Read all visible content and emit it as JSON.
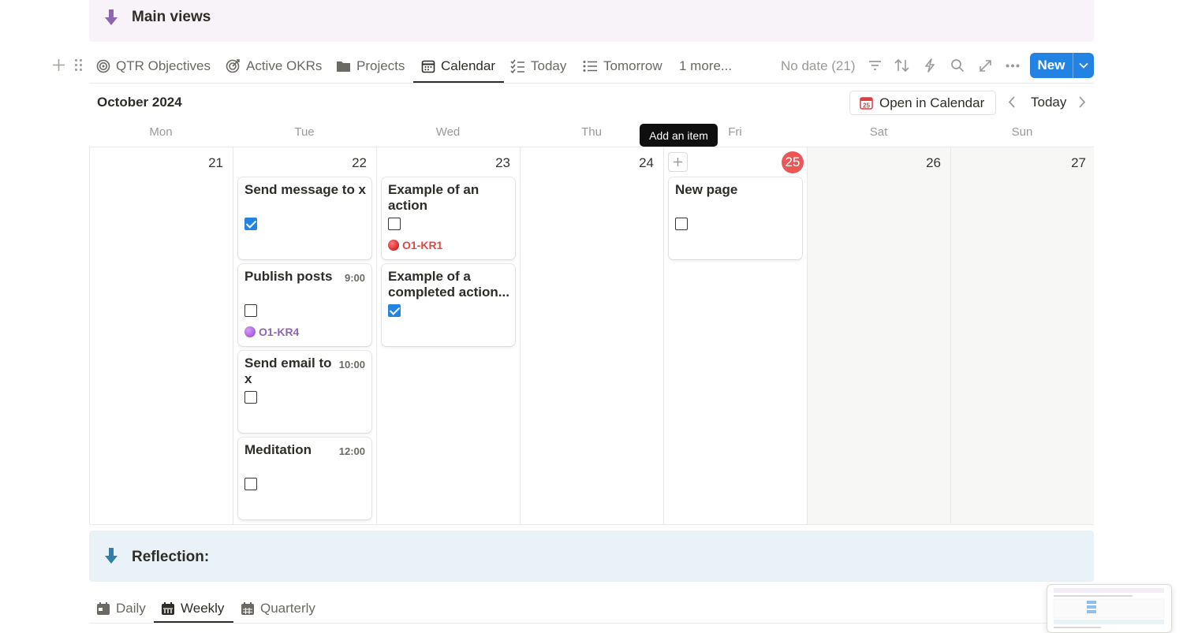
{
  "callouts": {
    "main_views": "Main views",
    "reflection": "Reflection:"
  },
  "view_tabs": [
    {
      "label": "QTR Objectives",
      "icon": "target-icon"
    },
    {
      "label": "Active OKRs",
      "icon": "target-arrow-icon"
    },
    {
      "label": "Projects",
      "icon": "folder-icon"
    },
    {
      "label": "Calendar",
      "icon": "calendar-icon",
      "active": true
    },
    {
      "label": "Today",
      "icon": "checklist-icon"
    },
    {
      "label": "Tomorrow",
      "icon": "list-icon"
    }
  ],
  "more_views": "1 more...",
  "toolbar": {
    "no_date": "No date (21)",
    "new_label": "New"
  },
  "calendar": {
    "month": "October 2024",
    "open_in_calendar": "Open in Calendar",
    "today_label": "Today",
    "weekdays": [
      "Mon",
      "Tue",
      "Wed",
      "Thu",
      "Fri",
      "Sat",
      "Sun"
    ],
    "days": [
      "21",
      "22",
      "23",
      "24",
      "25",
      "26",
      "27"
    ],
    "current_day": "25",
    "tooltip": "Add an item",
    "events": {
      "tue": [
        {
          "title": "Send message to x",
          "time": "",
          "checked": true,
          "okr": ""
        },
        {
          "title": "Publish posts",
          "time": "9:00",
          "checked": false,
          "okr": "O1-KR4"
        },
        {
          "title": "Send email to x",
          "time": "10:00",
          "checked": false,
          "okr": ""
        },
        {
          "title": "Meditation",
          "time": "12:00",
          "checked": false,
          "okr": ""
        }
      ],
      "wed": [
        {
          "title": "Example of an action",
          "time": "",
          "checked": false,
          "okr": "O1-KR1"
        },
        {
          "title": "Example of a completed action...",
          "time": "",
          "checked": true,
          "okr": ""
        }
      ],
      "fri": [
        {
          "title": "New page",
          "time": "",
          "checked": false,
          "okr": ""
        }
      ]
    }
  },
  "okr_colors": {
    "O1-KR4": "#9065b0",
    "O1-KR1": "#d44c47"
  },
  "accent": "#2383e2",
  "reflection_tabs": [
    {
      "label": "Daily",
      "icon": "calendar-day-icon"
    },
    {
      "label": "Weekly",
      "icon": "calendar-week-icon",
      "active": true
    },
    {
      "label": "Quarterly",
      "icon": "calendar-grid-icon"
    }
  ]
}
